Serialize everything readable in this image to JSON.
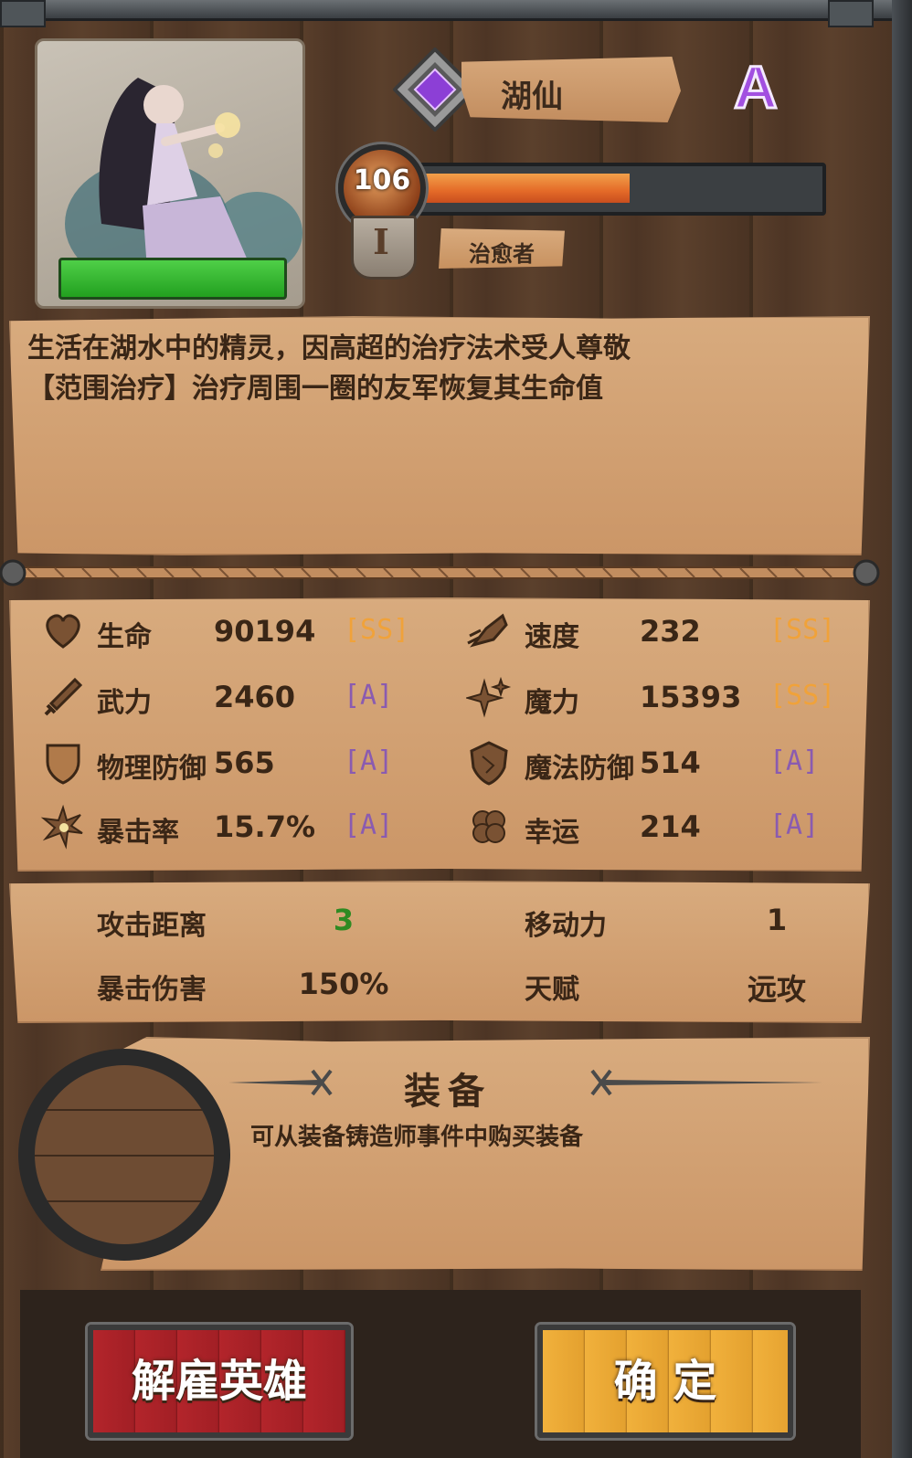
{
  "hero": {
    "name": "湖仙",
    "rank": "A",
    "level": "106",
    "xp_fraction": 0.53,
    "tier_badge": "I",
    "class": "治愈者"
  },
  "description": {
    "line1": "生活在湖水中的精灵，因高超的治疗法术受人尊敬",
    "line2": "【范围治疗】治疗周围一圈的友军恢复其生命值"
  },
  "stats": [
    {
      "label": "生命",
      "value": "90194",
      "grade": "[SS]",
      "grade_color": "#f0a23a",
      "icon": "heart-icon"
    },
    {
      "label": "速度",
      "value": "232",
      "grade": "[SS]",
      "grade_color": "#f0a23a",
      "icon": "speed-fist-icon"
    },
    {
      "label": "武力",
      "value": "2460",
      "grade": "[A]",
      "grade_color": "#8a5bb0",
      "icon": "sword-icon"
    },
    {
      "label": "魔力",
      "value": "15393",
      "grade": "[SS]",
      "grade_color": "#f0a23a",
      "icon": "magic-sparkle-icon"
    },
    {
      "label": "物理防御",
      "value": "565",
      "grade": "[A]",
      "grade_color": "#8a5bb0",
      "icon": "shield-icon"
    },
    {
      "label": "魔法防御",
      "value": "514",
      "grade": "[A]",
      "grade_color": "#8a5bb0",
      "icon": "magic-shield-icon"
    },
    {
      "label": "暴击率",
      "value": "15.7%",
      "grade": "[A]",
      "grade_color": "#8a5bb0",
      "icon": "burst-icon"
    },
    {
      "label": "幸运",
      "value": "214",
      "grade": "[A]",
      "grade_color": "#8a5bb0",
      "icon": "clover-icon"
    }
  ],
  "extra_stats": [
    {
      "label": "攻击距离",
      "value": "3",
      "value_color": "#2e8a22",
      "icon": "crosshair-icon"
    },
    {
      "label": "移动力",
      "value": "1",
      "value_color": "#3a2616",
      "icon": "boot-icon"
    },
    {
      "label": "暴击伤害",
      "value": "150%",
      "value_color": "#3a2616",
      "icon": "crit-damage-icon"
    },
    {
      "label": "天赋",
      "value": "远攻",
      "value_color": "#3a2616",
      "icon": "talent-icon"
    }
  ],
  "equipment": {
    "title": "装备",
    "subtitle": "可从装备铸造师事件中购买装备"
  },
  "buttons": {
    "dismiss": "解雇英雄",
    "confirm": "确 定"
  },
  "colors": {
    "parchment": "#d8ab7e",
    "wood": "#5a3f2b",
    "ss_grade": "#f0a23a",
    "a_grade": "#8a5bb0",
    "dismiss_red": "#b3252b",
    "confirm_gold": "#f1b13c"
  }
}
